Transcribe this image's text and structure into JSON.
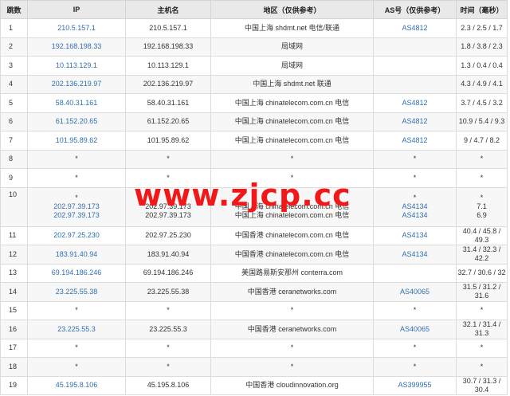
{
  "headers": [
    "跳数",
    "IP",
    "主机名",
    "地区（仅供参考）",
    "AS号（仅供参考）",
    "时间（毫秒）"
  ],
  "rows": [
    {
      "hop": "1",
      "ips": [
        "210.5.157.1"
      ],
      "hosts": [
        "210.5.157.1"
      ],
      "regions": [
        "中国上海 shdmt.net 电信/联通"
      ],
      "as": [
        "AS4812"
      ],
      "times": [
        "2.3 / 2.5 / 1.7"
      ]
    },
    {
      "hop": "2",
      "ips": [
        "192.168.198.33"
      ],
      "hosts": [
        "192.168.198.33"
      ],
      "regions": [
        "局域网"
      ],
      "as": [
        ""
      ],
      "times": [
        "1.8 / 3.8 / 2.3"
      ]
    },
    {
      "hop": "3",
      "ips": [
        "10.113.129.1"
      ],
      "hosts": [
        "10.113.129.1"
      ],
      "regions": [
        "局域网"
      ],
      "as": [
        ""
      ],
      "times": [
        "1.3 / 0.4 / 0.4"
      ]
    },
    {
      "hop": "4",
      "ips": [
        "202.136.219.97"
      ],
      "hosts": [
        "202.136.219.97"
      ],
      "regions": [
        "中国上海 shdmt.net 联通"
      ],
      "as": [
        ""
      ],
      "times": [
        "4.3 / 4.9 / 4.1"
      ]
    },
    {
      "hop": "5",
      "ips": [
        "58.40.31.161"
      ],
      "hosts": [
        "58.40.31.161"
      ],
      "regions": [
        "中国上海 chinatelecom.com.cn 电信"
      ],
      "as": [
        "AS4812"
      ],
      "times": [
        "3.7 / 4.5 / 3.2"
      ]
    },
    {
      "hop": "6",
      "ips": [
        "61.152.20.65"
      ],
      "hosts": [
        "61.152.20.65"
      ],
      "regions": [
        "中国上海 chinatelecom.com.cn 电信"
      ],
      "as": [
        "AS4812"
      ],
      "times": [
        "10.9 / 5.4 / 9.3"
      ]
    },
    {
      "hop": "7",
      "ips": [
        "101.95.89.62"
      ],
      "hosts": [
        "101.95.89.62"
      ],
      "regions": [
        "中国上海 chinatelecom.com.cn 电信"
      ],
      "as": [
        "AS4812"
      ],
      "times": [
        "9 / 4.7 / 8.2"
      ]
    },
    {
      "hop": "8",
      "ips": [
        "*"
      ],
      "hosts": [
        "*"
      ],
      "regions": [
        "*"
      ],
      "as": [
        "*"
      ],
      "times": [
        "*"
      ]
    },
    {
      "hop": "9",
      "ips": [
        "*"
      ],
      "hosts": [
        "*"
      ],
      "regions": [
        "*"
      ],
      "as": [
        "*"
      ],
      "times": [
        "*"
      ]
    },
    {
      "hop": "10",
      "ips": [
        "*",
        "202.97.39.173",
        "202.97.39.173"
      ],
      "hosts": [
        "",
        "202.97.39.173",
        "202.97.39.173"
      ],
      "regions": [
        "",
        "中国上海 chinatelecom.com.cn 电信",
        "中国上海 chinatelecom.com.cn 电信"
      ],
      "as": [
        "*",
        "AS4134",
        "AS4134"
      ],
      "times": [
        "*",
        "7.1",
        "6.9"
      ]
    },
    {
      "hop": "11",
      "ips": [
        "202.97.25.230"
      ],
      "hosts": [
        "202.97.25.230"
      ],
      "regions": [
        "中国香港 chinatelecom.com.cn 电信"
      ],
      "as": [
        "AS4134"
      ],
      "times": [
        "40.4 / 45.8 / 49.3"
      ]
    },
    {
      "hop": "12",
      "ips": [
        "183.91.40.94"
      ],
      "hosts": [
        "183.91.40.94"
      ],
      "regions": [
        "中国香港 chinatelecom.com.cn 电信"
      ],
      "as": [
        "AS4134"
      ],
      "times": [
        "31.4 / 32.3 / 42.2"
      ]
    },
    {
      "hop": "13",
      "ips": [
        "69.194.186.246"
      ],
      "hosts": [
        "69.194.186.246"
      ],
      "regions": [
        "美国路易斯安那州 conterra.com"
      ],
      "as": [
        ""
      ],
      "times": [
        "32.7 / 30.6 / 32"
      ]
    },
    {
      "hop": "14",
      "ips": [
        "23.225.55.38"
      ],
      "hosts": [
        "23.225.55.38"
      ],
      "regions": [
        "中国香港 ceranetworks.com"
      ],
      "as": [
        "AS40065"
      ],
      "times": [
        "31.5 / 31.2 / 31.6"
      ]
    },
    {
      "hop": "15",
      "ips": [
        "*"
      ],
      "hosts": [
        "*"
      ],
      "regions": [
        "*"
      ],
      "as": [
        "*"
      ],
      "times": [
        "*"
      ]
    },
    {
      "hop": "16",
      "ips": [
        "23.225.55.3"
      ],
      "hosts": [
        "23.225.55.3"
      ],
      "regions": [
        "中国香港 ceranetworks.com"
      ],
      "as": [
        "AS40065"
      ],
      "times": [
        "32.1 / 31.4 / 31.3"
      ]
    },
    {
      "hop": "17",
      "ips": [
        "*"
      ],
      "hosts": [
        "*"
      ],
      "regions": [
        "*"
      ],
      "as": [
        "*"
      ],
      "times": [
        "*"
      ]
    },
    {
      "hop": "18",
      "ips": [
        "*"
      ],
      "hosts": [
        "*"
      ],
      "regions": [
        "*"
      ],
      "as": [
        "*"
      ],
      "times": [
        "*"
      ]
    },
    {
      "hop": "19",
      "ips": [
        "45.195.8.106"
      ],
      "hosts": [
        "45.195.8.106"
      ],
      "regions": [
        "中国香港 cloudinnovation.org"
      ],
      "as": [
        "AS399955"
      ],
      "times": [
        "30.7 / 31.3 / 30.4"
      ]
    }
  ],
  "watermark": "www.zjcp.cc",
  "colors": {
    "link": "#2f6fb0",
    "watermark": "#f01818",
    "header_bg": "#e9e9e9",
    "alt_row": "#f7f7f7"
  }
}
